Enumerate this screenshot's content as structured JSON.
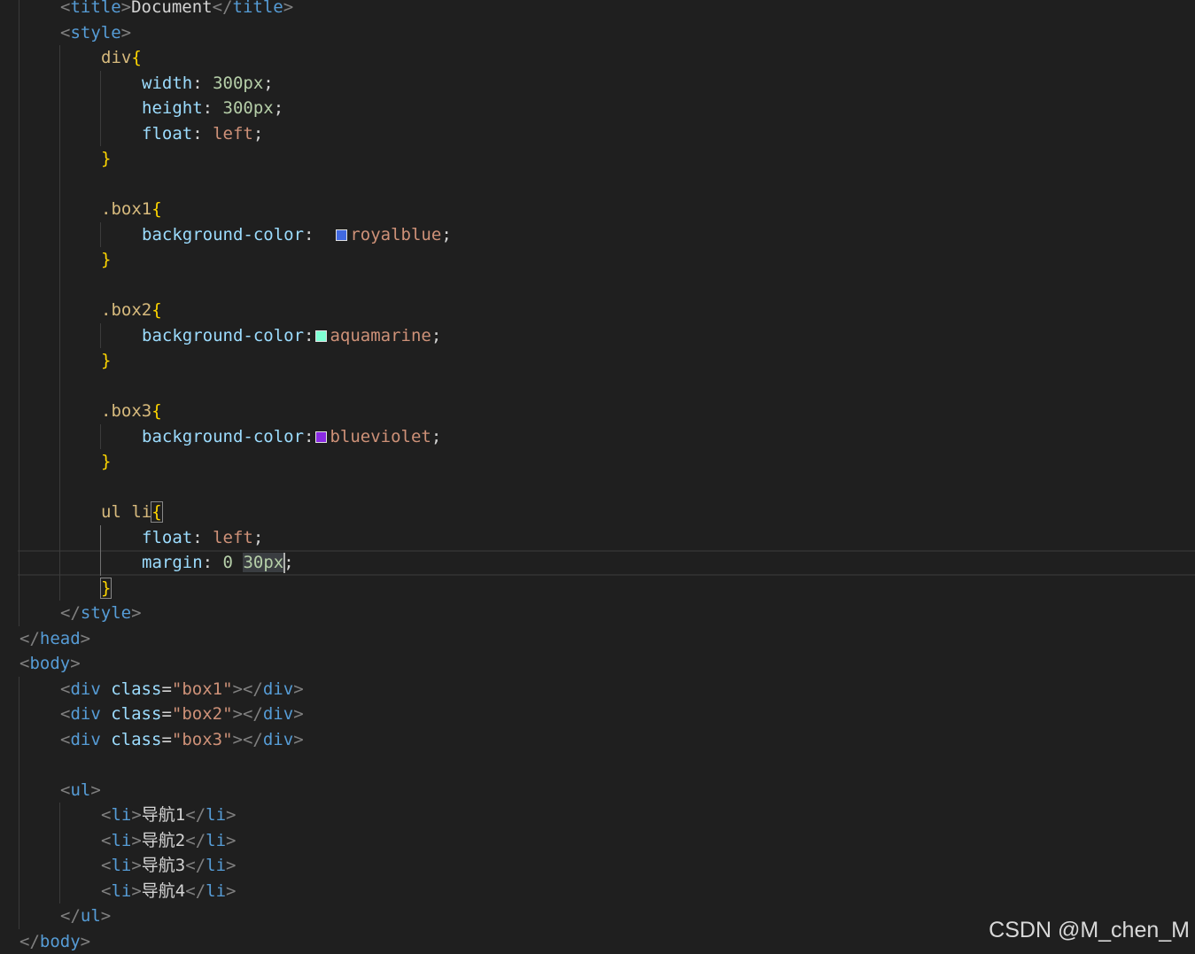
{
  "swatch_colors": {
    "royalblue": "#4169e1",
    "aquamarine": "#7fffd4",
    "blueviolet": "#8a2be2"
  },
  "lines": [
    {
      "indent": 1,
      "guides": [
        1
      ],
      "tokens": [
        {
          "t": "<",
          "c": "punc"
        },
        {
          "t": "title",
          "c": "tag"
        },
        {
          "t": ">",
          "c": "punc"
        },
        {
          "t": "Document",
          "c": "text"
        },
        {
          "t": "</",
          "c": "punc"
        },
        {
          "t": "title",
          "c": "tag"
        },
        {
          "t": ">",
          "c": "punc"
        }
      ]
    },
    {
      "indent": 1,
      "guides": [
        1
      ],
      "tokens": [
        {
          "t": "<",
          "c": "punc"
        },
        {
          "t": "style",
          "c": "tag"
        },
        {
          "t": ">",
          "c": "punc"
        }
      ]
    },
    {
      "indent": 2,
      "guides": [
        1,
        2
      ],
      "tokens": [
        {
          "t": "div",
          "c": "sel"
        },
        {
          "t": "{",
          "c": "brace"
        }
      ]
    },
    {
      "indent": 3,
      "guides": [
        1,
        2,
        3
      ],
      "tokens": [
        {
          "t": "width",
          "c": "prop"
        },
        {
          "t": ": ",
          "c": "text"
        },
        {
          "t": "300px",
          "c": "num"
        },
        {
          "t": ";",
          "c": "text"
        }
      ]
    },
    {
      "indent": 3,
      "guides": [
        1,
        2,
        3
      ],
      "tokens": [
        {
          "t": "height",
          "c": "prop"
        },
        {
          "t": ": ",
          "c": "text"
        },
        {
          "t": "300px",
          "c": "num"
        },
        {
          "t": ";",
          "c": "text"
        }
      ]
    },
    {
      "indent": 3,
      "guides": [
        1,
        2,
        3
      ],
      "tokens": [
        {
          "t": "float",
          "c": "prop"
        },
        {
          "t": ": ",
          "c": "text"
        },
        {
          "t": "left",
          "c": "val"
        },
        {
          "t": ";",
          "c": "text"
        }
      ]
    },
    {
      "indent": 2,
      "guides": [
        1,
        2
      ],
      "tokens": [
        {
          "t": "}",
          "c": "brace"
        }
      ]
    },
    {
      "indent": 0,
      "guides": [
        1,
        2
      ],
      "tokens": []
    },
    {
      "indent": 2,
      "guides": [
        1,
        2
      ],
      "tokens": [
        {
          "t": ".box1",
          "c": "sel"
        },
        {
          "t": "{",
          "c": "brace"
        }
      ]
    },
    {
      "indent": 3,
      "guides": [
        1,
        2,
        3
      ],
      "tokens": [
        {
          "t": "background-color",
          "c": "prop"
        },
        {
          "t": ":  ",
          "c": "text"
        },
        {
          "swatch": "royalblue"
        },
        {
          "t": "royalblue",
          "c": "val"
        },
        {
          "t": ";",
          "c": "text"
        }
      ]
    },
    {
      "indent": 2,
      "guides": [
        1,
        2
      ],
      "tokens": [
        {
          "t": "}",
          "c": "brace"
        }
      ]
    },
    {
      "indent": 0,
      "guides": [
        1,
        2
      ],
      "tokens": []
    },
    {
      "indent": 2,
      "guides": [
        1,
        2
      ],
      "tokens": [
        {
          "t": ".box2",
          "c": "sel"
        },
        {
          "t": "{",
          "c": "brace"
        }
      ]
    },
    {
      "indent": 3,
      "guides": [
        1,
        2,
        3
      ],
      "tokens": [
        {
          "t": "background-color",
          "c": "prop"
        },
        {
          "t": ":",
          "c": "text"
        },
        {
          "swatch": "aquamarine"
        },
        {
          "t": "aquamarine",
          "c": "val"
        },
        {
          "t": ";",
          "c": "text"
        }
      ]
    },
    {
      "indent": 2,
      "guides": [
        1,
        2
      ],
      "tokens": [
        {
          "t": "}",
          "c": "brace"
        }
      ]
    },
    {
      "indent": 0,
      "guides": [
        1,
        2
      ],
      "tokens": []
    },
    {
      "indent": 2,
      "guides": [
        1,
        2
      ],
      "tokens": [
        {
          "t": ".box3",
          "c": "sel"
        },
        {
          "t": "{",
          "c": "brace"
        }
      ]
    },
    {
      "indent": 3,
      "guides": [
        1,
        2,
        3
      ],
      "tokens": [
        {
          "t": "background-color",
          "c": "prop"
        },
        {
          "t": ":",
          "c": "text"
        },
        {
          "swatch": "blueviolet"
        },
        {
          "t": "blueviolet",
          "c": "val"
        },
        {
          "t": ";",
          "c": "text"
        }
      ]
    },
    {
      "indent": 2,
      "guides": [
        1,
        2
      ],
      "tokens": [
        {
          "t": "}",
          "c": "brace"
        }
      ]
    },
    {
      "indent": 0,
      "guides": [
        1,
        2
      ],
      "tokens": []
    },
    {
      "indent": 2,
      "guides": [
        1,
        2
      ],
      "tokens": [
        {
          "t": "ul li",
          "c": "sel"
        },
        {
          "t": "{",
          "c": "brace",
          "match": true
        }
      ]
    },
    {
      "indent": 3,
      "guides": [
        1,
        2,
        3
      ],
      "activeGuide": 3,
      "tokens": [
        {
          "t": "float",
          "c": "prop"
        },
        {
          "t": ": ",
          "c": "text"
        },
        {
          "t": "left",
          "c": "val"
        },
        {
          "t": ";",
          "c": "text"
        }
      ]
    },
    {
      "indent": 3,
      "guides": [
        1,
        2,
        3
      ],
      "activeGuide": 3,
      "current": true,
      "tokens": [
        {
          "t": "margin",
          "c": "prop"
        },
        {
          "t": ": ",
          "c": "text"
        },
        {
          "t": "0",
          "c": "num"
        },
        {
          "t": " ",
          "c": "text"
        },
        {
          "t": "30px",
          "c": "num",
          "hl": true
        },
        {
          "caret": true
        },
        {
          "t": ";",
          "c": "text"
        }
      ]
    },
    {
      "indent": 2,
      "guides": [
        1,
        2
      ],
      "tokens": [
        {
          "t": "}",
          "c": "brace",
          "match": true
        }
      ]
    },
    {
      "indent": 1,
      "guides": [
        1
      ],
      "tokens": [
        {
          "t": "</",
          "c": "punc"
        },
        {
          "t": "style",
          "c": "tag"
        },
        {
          "t": ">",
          "c": "punc"
        }
      ]
    },
    {
      "indent": 0,
      "guides": [],
      "tokens": [
        {
          "t": "</",
          "c": "punc"
        },
        {
          "t": "head",
          "c": "tag"
        },
        {
          "t": ">",
          "c": "punc"
        }
      ]
    },
    {
      "indent": 0,
      "guides": [],
      "tokens": [
        {
          "t": "<",
          "c": "punc"
        },
        {
          "t": "body",
          "c": "tag"
        },
        {
          "t": ">",
          "c": "punc"
        }
      ]
    },
    {
      "indent": 1,
      "guides": [
        1
      ],
      "tokens": [
        {
          "t": "<",
          "c": "punc"
        },
        {
          "t": "div",
          "c": "tag"
        },
        {
          "t": " ",
          "c": "text"
        },
        {
          "t": "class",
          "c": "attr"
        },
        {
          "t": "=",
          "c": "text"
        },
        {
          "t": "\"box1\"",
          "c": "str"
        },
        {
          "t": "></",
          "c": "punc"
        },
        {
          "t": "div",
          "c": "tag"
        },
        {
          "t": ">",
          "c": "punc"
        }
      ]
    },
    {
      "indent": 1,
      "guides": [
        1
      ],
      "tokens": [
        {
          "t": "<",
          "c": "punc"
        },
        {
          "t": "div",
          "c": "tag"
        },
        {
          "t": " ",
          "c": "text"
        },
        {
          "t": "class",
          "c": "attr"
        },
        {
          "t": "=",
          "c": "text"
        },
        {
          "t": "\"box2\"",
          "c": "str"
        },
        {
          "t": "></",
          "c": "punc"
        },
        {
          "t": "div",
          "c": "tag"
        },
        {
          "t": ">",
          "c": "punc"
        }
      ]
    },
    {
      "indent": 1,
      "guides": [
        1
      ],
      "tokens": [
        {
          "t": "<",
          "c": "punc"
        },
        {
          "t": "div",
          "c": "tag"
        },
        {
          "t": " ",
          "c": "text"
        },
        {
          "t": "class",
          "c": "attr"
        },
        {
          "t": "=",
          "c": "text"
        },
        {
          "t": "\"box3\"",
          "c": "str"
        },
        {
          "t": "></",
          "c": "punc"
        },
        {
          "t": "div",
          "c": "tag"
        },
        {
          "t": ">",
          "c": "punc"
        }
      ]
    },
    {
      "indent": 0,
      "guides": [
        1
      ],
      "tokens": []
    },
    {
      "indent": 1,
      "guides": [
        1
      ],
      "tokens": [
        {
          "t": "<",
          "c": "punc"
        },
        {
          "t": "ul",
          "c": "tag"
        },
        {
          "t": ">",
          "c": "punc"
        }
      ]
    },
    {
      "indent": 2,
      "guides": [
        1,
        2
      ],
      "tokens": [
        {
          "t": "<",
          "c": "punc"
        },
        {
          "t": "li",
          "c": "tag"
        },
        {
          "t": ">",
          "c": "punc"
        },
        {
          "t": "导航1",
          "c": "text"
        },
        {
          "t": "</",
          "c": "punc"
        },
        {
          "t": "li",
          "c": "tag"
        },
        {
          "t": ">",
          "c": "punc"
        }
      ]
    },
    {
      "indent": 2,
      "guides": [
        1,
        2
      ],
      "tokens": [
        {
          "t": "<",
          "c": "punc"
        },
        {
          "t": "li",
          "c": "tag"
        },
        {
          "t": ">",
          "c": "punc"
        },
        {
          "t": "导航2",
          "c": "text"
        },
        {
          "t": "</",
          "c": "punc"
        },
        {
          "t": "li",
          "c": "tag"
        },
        {
          "t": ">",
          "c": "punc"
        }
      ]
    },
    {
      "indent": 2,
      "guides": [
        1,
        2
      ],
      "tokens": [
        {
          "t": "<",
          "c": "punc"
        },
        {
          "t": "li",
          "c": "tag"
        },
        {
          "t": ">",
          "c": "punc"
        },
        {
          "t": "导航3",
          "c": "text"
        },
        {
          "t": "</",
          "c": "punc"
        },
        {
          "t": "li",
          "c": "tag"
        },
        {
          "t": ">",
          "c": "punc"
        }
      ]
    },
    {
      "indent": 2,
      "guides": [
        1,
        2
      ],
      "tokens": [
        {
          "t": "<",
          "c": "punc"
        },
        {
          "t": "li",
          "c": "tag"
        },
        {
          "t": ">",
          "c": "punc"
        },
        {
          "t": "导航4",
          "c": "text"
        },
        {
          "t": "</",
          "c": "punc"
        },
        {
          "t": "li",
          "c": "tag"
        },
        {
          "t": ">",
          "c": "punc"
        }
      ]
    },
    {
      "indent": 1,
      "guides": [
        1
      ],
      "tokens": [
        {
          "t": "</",
          "c": "punc"
        },
        {
          "t": "ul",
          "c": "tag"
        },
        {
          "t": ">",
          "c": "punc"
        }
      ]
    },
    {
      "indent": 0,
      "guides": [],
      "tokens": [
        {
          "t": "</",
          "c": "punc"
        },
        {
          "t": "body",
          "c": "tag"
        },
        {
          "t": ">",
          "c": "punc"
        }
      ]
    }
  ],
  "watermark": "CSDN @M_chen_M"
}
